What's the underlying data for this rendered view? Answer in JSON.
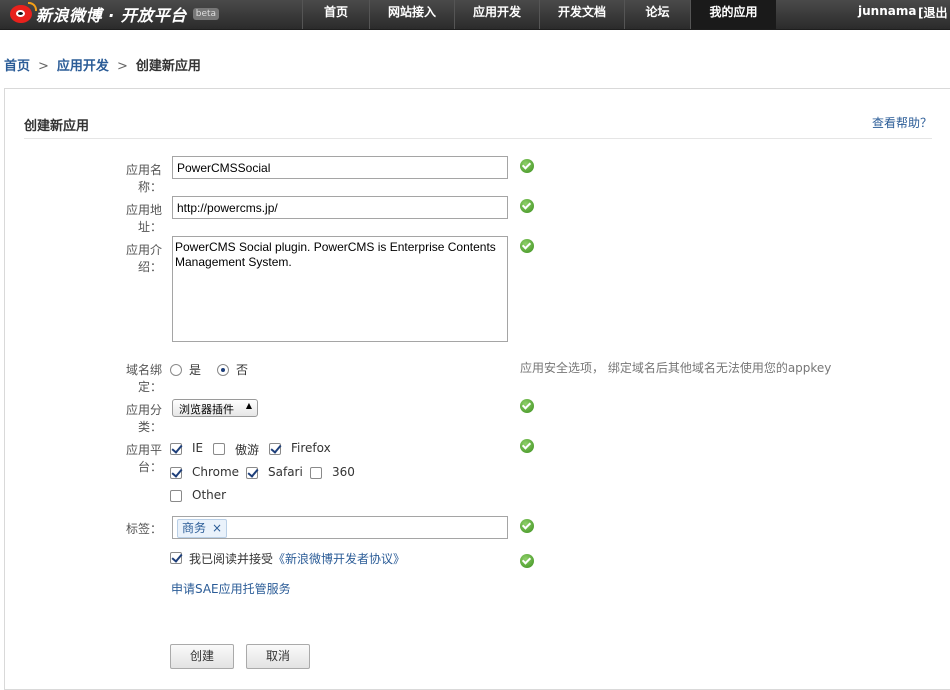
{
  "header": {
    "logo_text": "新浪微博 · 开放平台",
    "beta": "beta",
    "nav": [
      {
        "label": "首页"
      },
      {
        "label": "网站接入"
      },
      {
        "label": "应用开发"
      },
      {
        "label": "开发文档"
      },
      {
        "label": "论坛"
      },
      {
        "label": "我的应用",
        "active": true
      }
    ],
    "username": "junnama",
    "logout": "[退出"
  },
  "breadcrumb": {
    "home": "首页",
    "sep1": ">",
    "dev": "应用开发",
    "sep2": ">",
    "current": "创建新应用"
  },
  "panel": {
    "title": "创建新应用",
    "help": "查看帮助？"
  },
  "form": {
    "name_label": "应用名称：",
    "name_value": "PowerCMSSocial",
    "url_label": "应用地址：",
    "url_value": "http://powercms.jp/",
    "desc_label": "应用介绍：",
    "desc_value": "PowerCMS Social plugin. PowerCMS is Enterprise Contents Management System.",
    "domain_label": "域名绑定：",
    "domain_yes": "是",
    "domain_no": "否",
    "domain_selected": "否",
    "domain_hint": "应用安全选项，  绑定域名后其他域名无法使用您的appkey",
    "category_label": "应用分类：",
    "category_value": "浏览器插件",
    "platform_label": "应用平台：",
    "platforms": [
      {
        "label": "IE",
        "checked": true
      },
      {
        "label": "傲游",
        "checked": false
      },
      {
        "label": "Firefox",
        "checked": true
      },
      {
        "label": "Chrome",
        "checked": true
      },
      {
        "label": "Safari",
        "checked": true
      },
      {
        "label": "360",
        "checked": false
      },
      {
        "label": "Other",
        "checked": false
      }
    ],
    "tags_label": "标签：",
    "tag": "商务",
    "tag_remove": "×",
    "agree_text": "我已阅读并接受",
    "agree_link": "《新浪微博开发者协议》",
    "agree_checked": true,
    "sae_link": "申请SAE应用托管服务",
    "create_button": "创建",
    "cancel_button": "取消"
  },
  "colors": {
    "topbar": "#333333",
    "link": "#2b5c97",
    "ok": "#3b8f1d"
  }
}
